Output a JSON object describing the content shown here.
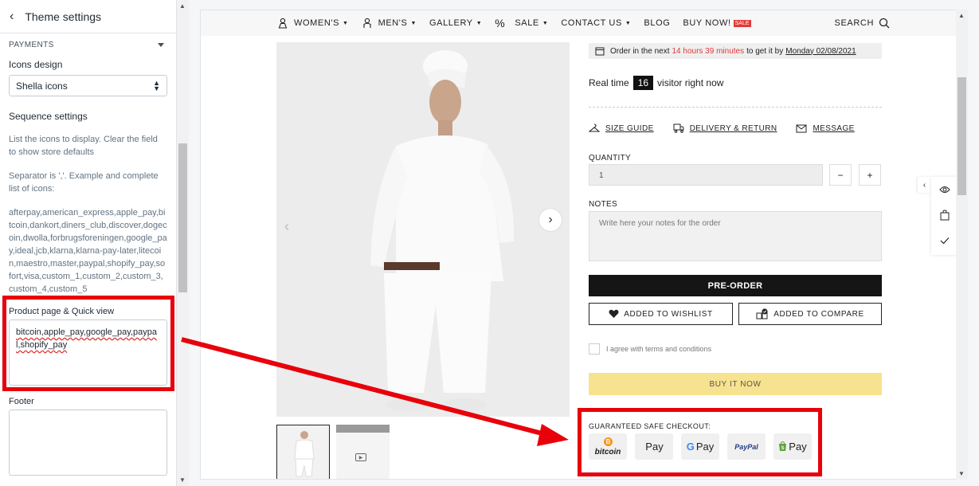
{
  "sidebar": {
    "title": "Theme settings",
    "section": "PAYMENTS",
    "icons_design_label": "Icons design",
    "icons_design_value": "Shella icons",
    "sequence_heading": "Sequence settings",
    "help1": "List the icons to display. Clear the field to show store defaults",
    "help2": "Separator is ','. Example and complete list of icons:",
    "icons_list": "afterpay,american_express,apple_pay,bitcoin,dankort,diners_club,discover,dogecoin,dwolla,forbrugsforeningen,google_pay,ideal,jcb,klarna,klarna-pay-later,litecoin,maestro,master,paypal,shopify_pay,sofort,visa,custom_1,custom_2,custom_3,custom_4,custom_5",
    "product_label": "Product page & Quick view",
    "product_value": "bitcoin,apple_pay,google_pay,paypal,shopify_pay",
    "footer_label": "Footer"
  },
  "nav": {
    "items": [
      "WOMEN'S",
      "MEN'S",
      "GALLERY",
      "SALE",
      "CONTACT US",
      "BLOG",
      "BUY NOW!"
    ],
    "sale_badge": "SALE",
    "search": "SEARCH"
  },
  "product": {
    "order_pre": "Order in the next",
    "order_time": "14 hours 39 minutes",
    "order_mid": "to get it by",
    "order_date": "Monday 02/08/2021",
    "realtime_pre": "Real time",
    "visitors": "16",
    "realtime_post": "visitor right now",
    "size_guide": "SIZE GUIDE",
    "delivery": "DELIVERY & RETURN",
    "message": "MESSAGE",
    "quantity_label": "QUANTITY",
    "quantity_value": "1",
    "minus": "−",
    "plus": "+",
    "notes_label": "NOTES",
    "notes_placeholder": "Write here your notes for the order",
    "preorder": "PRE-ORDER",
    "wishlist": "ADDED TO WISHLIST",
    "compare": "ADDED TO COMPARE",
    "agree": "I agree with terms and conditions",
    "buy_now": "BUY IT NOW",
    "safe_checkout": "GUARANTEED SAFE CHECKOUT:",
    "payments": [
      "bitcoin",
      "Pay",
      "Pay",
      "PayPal",
      "Pay"
    ]
  },
  "colors": {
    "highlight": "#e8000b",
    "buy_now_bg": "#f7e28f",
    "countdown": "#e13a3a"
  }
}
